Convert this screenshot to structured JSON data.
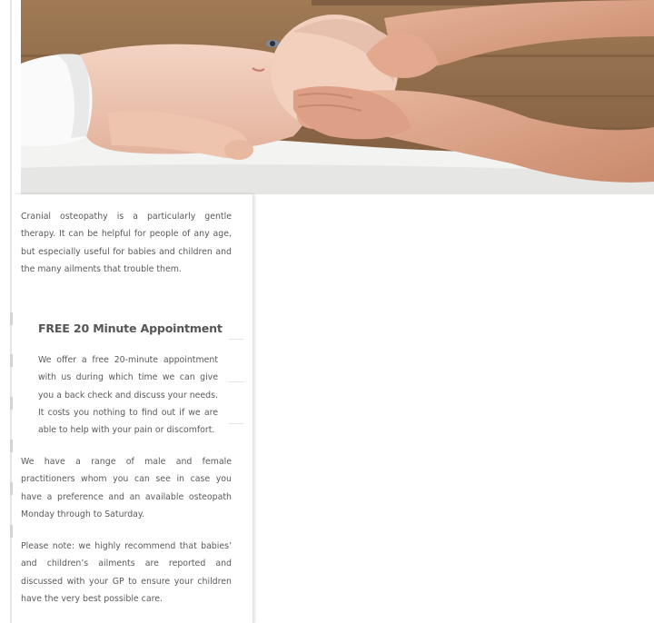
{
  "hero": {
    "image_description_icon": "baby-cranial-therapy-photo"
  },
  "intro": {
    "text": "Cranial osteopathy is a particularly gentle therapy. It can be helpful for people of any age, but especially useful for babies and children and the many ailments that trouble them."
  },
  "offer": {
    "title": "FREE 20 Minute Appointment",
    "text": "We offer a free 20-minute appointment with us during which time we can give you a back check and discuss your needs. It costs you nothing to find out if we are able to help with your pain or discomfort."
  },
  "practitioners": {
    "text": "We have a range of male and female practitioners whom you can see in case you have a preference and an available osteopath Monday through to Saturday."
  },
  "note": {
    "text": "Please note: we highly recommend that babies’ and children’s ailments are reported and discussed with your GP to ensure your children have the very best possible care."
  }
}
